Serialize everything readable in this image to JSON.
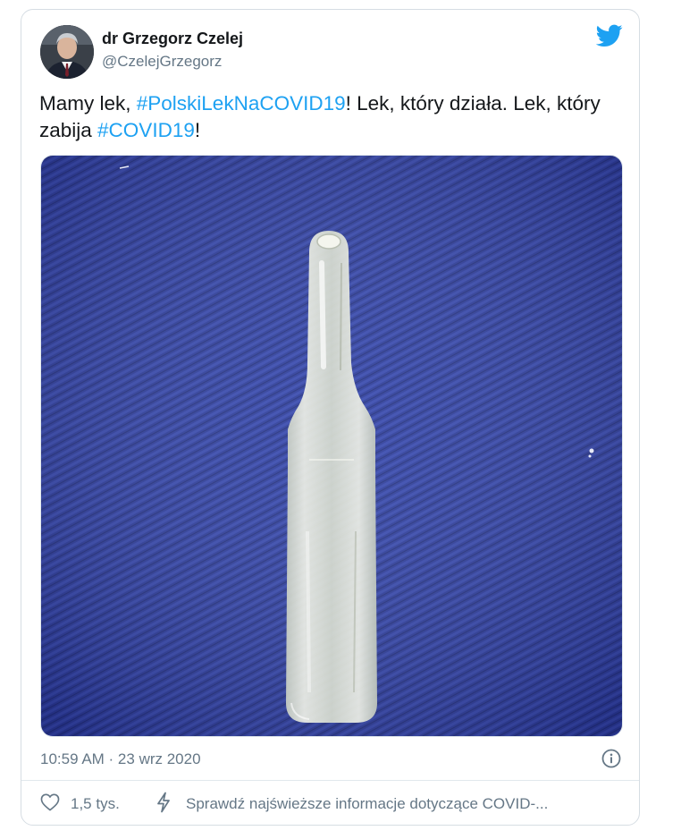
{
  "author": {
    "name": "dr Grzegorz Czelej",
    "handle": "@CzelejGrzegorz"
  },
  "tweet": {
    "text_part1": "Mamy lek, ",
    "hashtag1": "#PolskiLekNaCOVID19",
    "text_part2": "! Lek, który działa. Lek, który zabija ",
    "hashtag2": "#COVID19",
    "text_part3": "!"
  },
  "timestamp": "10:59 AM · 23 wrz 2020",
  "actions": {
    "likes": "1,5 tys.",
    "covid_info": "Sprawdź najświeższe informacje dotyczące COVID-..."
  },
  "icons": {
    "brand": "twitter-bird-icon",
    "info": "info-icon",
    "like": "heart-icon",
    "covid": "lightning-icon"
  },
  "colors": {
    "hashtag": "#1da1f2",
    "secondary_text": "#657786",
    "brand": "#1da1f2",
    "photo_background": "#2f3f9c"
  }
}
